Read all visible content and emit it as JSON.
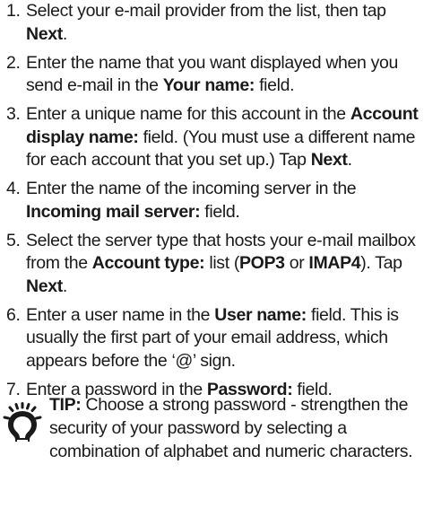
{
  "steps": [
    {
      "num": "1.",
      "parts": [
        {
          "t": "Select your e-mail provider from the list, then tap ",
          "b": false
        },
        {
          "t": "Next",
          "b": true
        },
        {
          "t": ".",
          "b": false
        }
      ]
    },
    {
      "num": "2.",
      "parts": [
        {
          "t": "Enter the name that you want displayed when you send e-mail in the ",
          "b": false
        },
        {
          "t": "Your name:",
          "b": true
        },
        {
          "t": " field.",
          "b": false
        }
      ]
    },
    {
      "num": "3.",
      "parts": [
        {
          "t": "Enter a unique name for this account in the ",
          "b": false
        },
        {
          "t": "Account display name:",
          "b": true
        },
        {
          "t": " field. (You must use a different name for each account that you set up.) Tap ",
          "b": false
        },
        {
          "t": "Next",
          "b": true
        },
        {
          "t": ".",
          "b": false
        }
      ]
    },
    {
      "num": "4.",
      "parts": [
        {
          "t": "Enter the name of the incoming server in the ",
          "b": false
        },
        {
          "t": "Incoming mail server:",
          "b": true
        },
        {
          "t": " field.",
          "b": false
        }
      ]
    },
    {
      "num": "5.",
      "parts": [
        {
          "t": "Select the server type that hosts your e-mail mailbox from the ",
          "b": false
        },
        {
          "t": "Account type:",
          "b": true
        },
        {
          "t": " list (",
          "b": false
        },
        {
          "t": "POP3",
          "b": true
        },
        {
          "t": " or ",
          "b": false
        },
        {
          "t": "IMAP4",
          "b": true
        },
        {
          "t": "). Tap ",
          "b": false
        },
        {
          "t": "Next",
          "b": true
        },
        {
          "t": ".",
          "b": false
        }
      ]
    },
    {
      "num": "6.",
      "parts": [
        {
          "t": "Enter a user name in the ",
          "b": false
        },
        {
          "t": "User name:",
          "b": true
        },
        {
          "t": " field. This is usually the first part of your email address, which appears before the ‘@’ sign.",
          "b": false
        }
      ]
    },
    {
      "num": "7.",
      "parts": [
        {
          "t": "Enter a password in the ",
          "b": false
        },
        {
          "t": "Password:",
          "b": true
        },
        {
          "t": " field.",
          "b": false
        }
      ]
    }
  ],
  "tip": {
    "label": "TIP:",
    "text": " Choose a strong password - strengthen the security of your password by selecting a combination of alphabet and numeric characters.",
    "icon": "lightbulb-icon",
    "icon_color": "#1a1a1a"
  }
}
